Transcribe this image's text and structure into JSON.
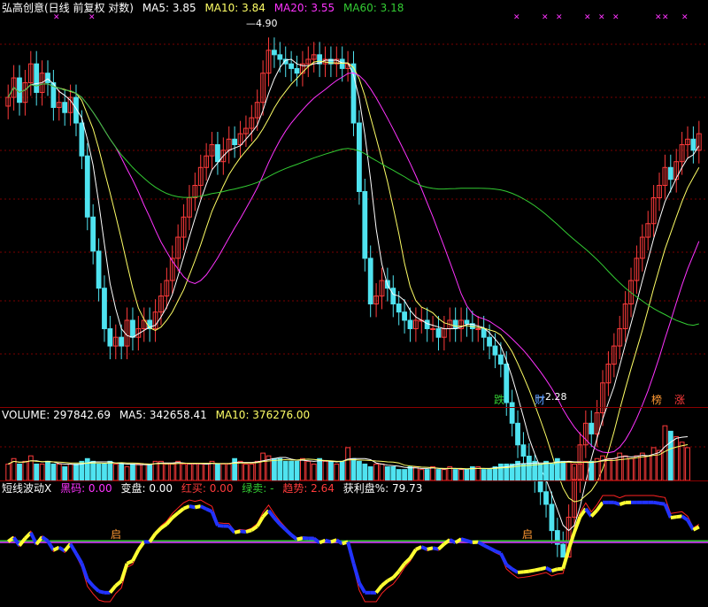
{
  "colors": {
    "up": "#ff3b3b",
    "down": "#4fe3f0",
    "ma5": "#ffffff",
    "ma10": "#ffff66",
    "ma20": "#ff33ff",
    "ma60": "#33cc33",
    "grid": "#7a0000",
    "bg": "#000000"
  },
  "main_header": {
    "title": "弘高创意(日线 前复权 对数)",
    "ma5": "MA5: 3.85",
    "ma10": "MA10: 3.84",
    "ma20": "MA20: 3.55",
    "ma60": "MA60: 3.18"
  },
  "volume_header": {
    "vol": "VOLUME: 297842.69",
    "ma5": "MA5: 342658.41",
    "ma10": "MA10: 376276.00"
  },
  "indicator_header": {
    "name": "短线波动X",
    "black": "黑码: 0.00",
    "change": "变盘: 0.00",
    "red": "红买: 0.00",
    "green": "绿卖: -",
    "trend": "趋势: 2.64",
    "profit": "获利盘%: 79.73"
  },
  "annotations": {
    "high_label": "4.90",
    "low_label": "2.28",
    "tag_die": "跌",
    "tag_cai": "财",
    "tag_bang": "榜",
    "tag_zhang": "涨",
    "tag_qi": "启",
    "star": "✕"
  },
  "chart_data": {
    "type": "candlestick",
    "scale": "log",
    "ylim": [
      2.15,
      5.25
    ],
    "high": 4.9,
    "low": 2.28,
    "closes": [
      4.35,
      4.55,
      4.3,
      4.5,
      4.7,
      4.4,
      4.6,
      4.5,
      4.25,
      4.3,
      4.2,
      4.35,
      4.1,
      3.8,
      3.3,
      3.05,
      2.8,
      2.55,
      2.45,
      2.5,
      2.45,
      2.6,
      2.5,
      2.55,
      2.6,
      2.55,
      2.65,
      2.75,
      2.85,
      3.0,
      3.15,
      3.3,
      3.45,
      3.55,
      3.7,
      3.8,
      3.9,
      3.75,
      3.85,
      3.95,
      3.9,
      4.0,
      4.05,
      4.15,
      4.3,
      4.6,
      4.85,
      4.8,
      4.75,
      4.7,
      4.65,
      4.6,
      4.7,
      4.75,
      4.8,
      4.7,
      4.75,
      4.7,
      4.75,
      4.65,
      4.7,
      4.1,
      3.5,
      3.0,
      2.7,
      2.75,
      2.85,
      2.8,
      2.7,
      2.65,
      2.6,
      2.55,
      2.6,
      2.6,
      2.55,
      2.55,
      2.5,
      2.55,
      2.6,
      2.55,
      2.6,
      2.58,
      2.55,
      2.55,
      2.5,
      2.45,
      2.4,
      2.35,
      2.15,
      2.05,
      1.95,
      1.9,
      1.85,
      1.8,
      1.75,
      1.7,
      1.6,
      1.55,
      1.5,
      1.65,
      1.8,
      1.95,
      2.05,
      2.0,
      2.1,
      2.25,
      2.35,
      2.45,
      2.55,
      2.7,
      2.85,
      3.0,
      3.15,
      3.25,
      3.45,
      3.55,
      3.7,
      3.6,
      3.75,
      3.9,
      3.95,
      3.85,
      4.0
    ],
    "volume": [
      0.3,
      0.4,
      0.3,
      0.35,
      0.45,
      0.3,
      0.3,
      0.35,
      0.3,
      0.3,
      0.25,
      0.3,
      0.3,
      0.35,
      0.4,
      0.35,
      0.3,
      0.3,
      0.35,
      0.3,
      0.3,
      0.25,
      0.3,
      0.3,
      0.3,
      0.3,
      0.35,
      0.35,
      0.3,
      0.3,
      0.35,
      0.3,
      0.3,
      0.3,
      0.3,
      0.3,
      0.35,
      0.3,
      0.3,
      0.3,
      0.4,
      0.35,
      0.3,
      0.3,
      0.35,
      0.5,
      0.45,
      0.4,
      0.4,
      0.35,
      0.35,
      0.35,
      0.4,
      0.35,
      0.3,
      0.4,
      0.35,
      0.35,
      0.3,
      0.35,
      0.6,
      0.4,
      0.35,
      0.3,
      0.25,
      0.3,
      0.3,
      0.25,
      0.25,
      0.2,
      0.2,
      0.25,
      0.25,
      0.2,
      0.2,
      0.25,
      0.2,
      0.2,
      0.25,
      0.2,
      0.2,
      0.2,
      0.25,
      0.25,
      0.2,
      0.2,
      0.25,
      0.3,
      0.3,
      0.3,
      0.35,
      0.3,
      0.3,
      0.35,
      0.3,
      0.35,
      0.3,
      0.4,
      0.35,
      0.35,
      0.3,
      0.3,
      0.35,
      0.35,
      0.4,
      0.45,
      0.4,
      0.4,
      0.5,
      0.45,
      0.4,
      0.45,
      0.5,
      0.45,
      0.6,
      0.55,
      1.0,
      0.9,
      0.8,
      0.7,
      0.6
    ]
  }
}
